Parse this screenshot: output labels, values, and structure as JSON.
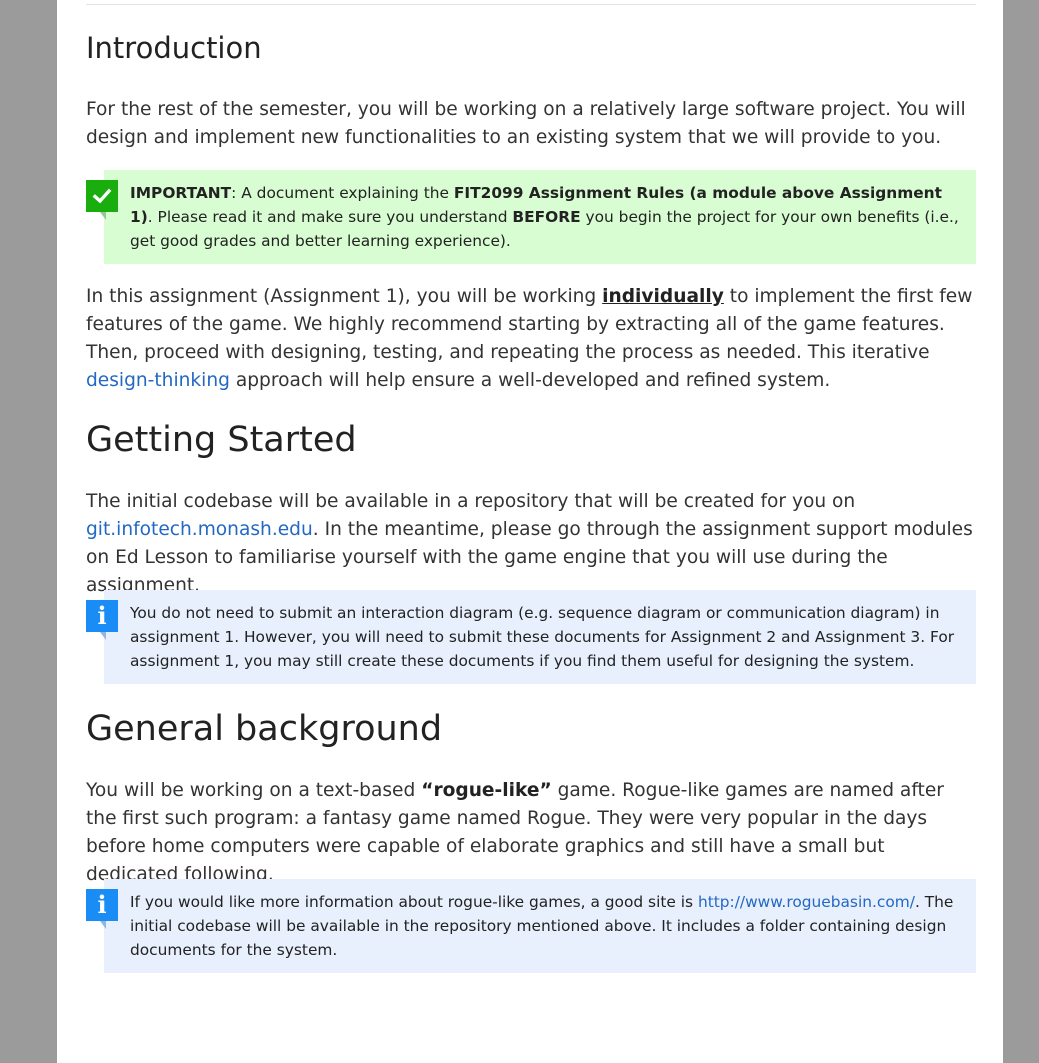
{
  "intro": {
    "heading": "Introduction",
    "paragraph": {
      "text": "For the rest of the semester, you will be working on a relatively large software project. You will design and implement new functionalities to an existing system that we will provide to you."
    },
    "important_callout": {
      "icon": "checkmark-icon",
      "label": "IMPORTANT",
      "text_1": ": A document explaining the ",
      "bold_doc": "FIT2099 Assignment Rules (a module above Assignment 1)",
      "text_2": ". Please read it and make sure you understand ",
      "bold_before": "BEFORE",
      "text_3": " you begin the project for your own benefits (i.e., get good grades and better learning experience).",
      "color": "#d9fdd2",
      "icon_color": "#1aad0e"
    },
    "paragraph2": {
      "text_1": "In this assignment (Assignment 1), you will be working ",
      "emphasis": "individually",
      "text_2": " to implement the first few features of the game. We highly recommend starting by extracting all of the game features. Then, proceed with designing, testing, and repeating the process as needed. This iterative ",
      "link": "design-thinking",
      "text_3": " approach will help ensure a well-developed and refined system."
    }
  },
  "getting_started": {
    "heading": "Getting Started",
    "paragraph": {
      "text_1": "The initial codebase will be available in a repository that will be created for you on ",
      "link": "git.infotech.monash.edu",
      "text_2": ". In the meantime, please go through the assignment support modules on Ed Lesson to familiarise yourself with the game engine that you will use during the assignment."
    },
    "info_callout": {
      "icon": "info-icon",
      "icon_glyph": "i",
      "text": "You do not need to submit an interaction diagram (e.g. sequence diagram or communication diagram) in assignment 1. However, you will need to submit these documents for Assignment 2 and Assignment 3. For assignment 1, you may still create these documents if you find them useful for designing the system.",
      "color": "#e8f0fd",
      "icon_color": "#1a8cf5"
    }
  },
  "general_background": {
    "heading": "General background",
    "paragraph": {
      "text_1": "You will be working on a text-based ",
      "bold": "“rogue-like”",
      "text_2": " game. Rogue-like games are named after the first such program: a fantasy game named Rogue. They were very popular in the days before home computers were capable of elaborate graphics and still have a small but dedicated following."
    },
    "info_callout": {
      "icon": "info-icon",
      "icon_glyph": "i",
      "text_1": "If you would like more information about rogue-like games, a good site is ",
      "link": "http://www.roguebasin.com/",
      "text_2": ". The initial codebase will be available in the repository mentioned above. It includes a folder containing design documents for the system."
    }
  }
}
